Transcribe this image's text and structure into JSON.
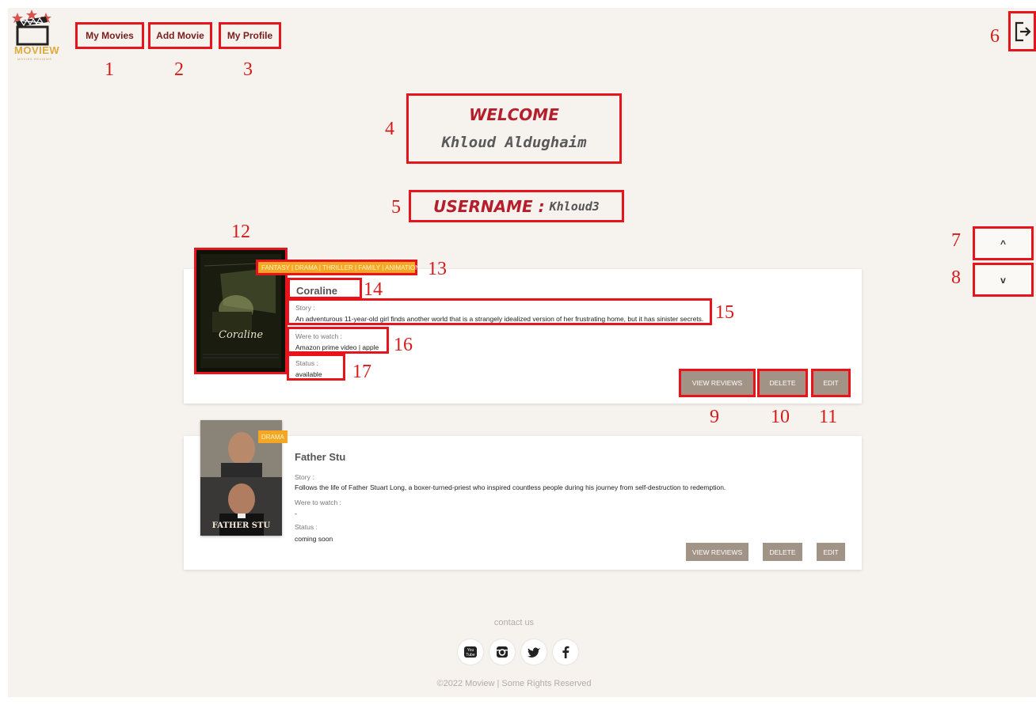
{
  "logo": {
    "wordmark": "MOVIEW",
    "tagline": "MOVIES REVIEWS"
  },
  "nav": {
    "my_movies": "My Movies",
    "add_movie": "Add Movie",
    "my_profile": "My Profile"
  },
  "welcome": {
    "heading": "WELCOME",
    "name": "Khloud Aldughaim"
  },
  "username": {
    "label": "USERNAME :",
    "value": "Khloud3"
  },
  "scroll": {
    "up": "^",
    "down": "v"
  },
  "movies": [
    {
      "genres": "FANTASY | DRAMA | THRILLER | FAMILY | ANIMATION",
      "title": "Coraline",
      "story_label": "Story :",
      "story": "An adventurous 11-year-old girl finds another world that is a strangely idealized version of her frustrating home, but it has sinister secrets.",
      "watch_label": "Were to watch :",
      "watch": "Amazon prime video | apple",
      "status_label": "Status :",
      "status": "available",
      "poster_text": "Coraline"
    },
    {
      "genres": "DRAMA",
      "title": "Father Stu",
      "story_label": "Story :",
      "story": "Follows the life of Father Stuart Long, a boxer-turned-priest who inspired countless people during his journey from self-destruction to redemption.",
      "watch_label": "Were to watch :",
      "watch": "-",
      "status_label": "Status :",
      "status": "coming soon",
      "poster_text": "FATHER STU"
    }
  ],
  "buttons": {
    "view_reviews": "VIEW REVIEWS",
    "delete": "DELETE",
    "edit": "EDIT"
  },
  "annotations": [
    "1",
    "2",
    "3",
    "4",
    "5",
    "6",
    "7",
    "8",
    "9",
    "10",
    "11",
    "12",
    "13",
    "14",
    "15",
    "16",
    "17"
  ],
  "footer": {
    "contact": "contact us",
    "copyright": "©2022 Moview | Some Rights Reserved"
  },
  "colors": {
    "accent": "#b51f2b",
    "highlight": "#e8141c",
    "tag": "#f5a623",
    "button": "#a29387",
    "background": "#f6f3ef"
  }
}
